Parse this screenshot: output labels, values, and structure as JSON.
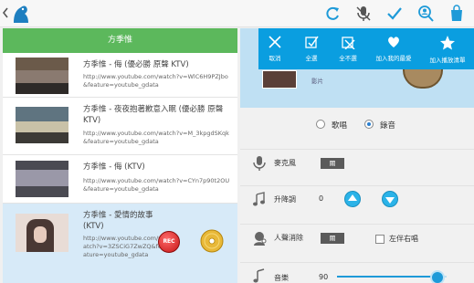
{
  "topbar": {
    "icons": [
      "back-chevron-icon",
      "app-logo-icon",
      "refresh-icon",
      "mic-off-icon",
      "check-icon",
      "search-user-icon",
      "shopping-bag-icon"
    ],
    "accent": "#1e9ad8"
  },
  "list": {
    "header": "方季惟",
    "header_color": "#5cb85c",
    "items": [
      {
        "title": "方季惟 - 侮 (優必勝 原聲 KTV)",
        "url": "http://www.youtube.com/watch?v=WlC6H9PZJbo&feature=youtube_gdata",
        "selected": false
      },
      {
        "title": "方季惟 - 夜夜抱著歉意入眠 (優必勝 原聲KTV)",
        "url": "http://www.youtube.com/watch?v=M_3kpgdSKqk&feature=youtube_gdata",
        "selected": false
      },
      {
        "title": "方季惟 - 侮 (KTV)",
        "url": "http://www.youtube.com/watch?v=CYn7p90t2OU&feature=youtube_gdata",
        "selected": false
      },
      {
        "title": "方季惟 - 愛情的故事 (KTV)",
        "url": "http://www.youtube.com/watch?v=3ZSCiG7ZwZQ&feature=youtube_gdata",
        "selected": true
      }
    ],
    "rec_label": "REC"
  },
  "actions": [
    {
      "label": "取消",
      "icon": "close-icon"
    },
    {
      "label": "全選",
      "icon": "select-all-icon"
    },
    {
      "label": "全不選",
      "icon": "deselect-all-icon"
    },
    {
      "label": "加入我的最愛",
      "icon": "heart-icon"
    },
    {
      "label": "加入播放清單",
      "icon": "star-icon"
    }
  ],
  "preview": {
    "caption": "影片"
  },
  "mode": {
    "options": [
      "歌唱",
      "錄音"
    ],
    "selected": "錄音"
  },
  "settings": {
    "mic": {
      "label": "麥克風",
      "toggle": "關"
    },
    "pitch": {
      "label": "升降調",
      "value": "0"
    },
    "vocal": {
      "label": "人聲消除",
      "toggle": "關",
      "checkbox_label": "左伴右唱"
    },
    "music": {
      "label": "音樂",
      "value": "90"
    }
  }
}
